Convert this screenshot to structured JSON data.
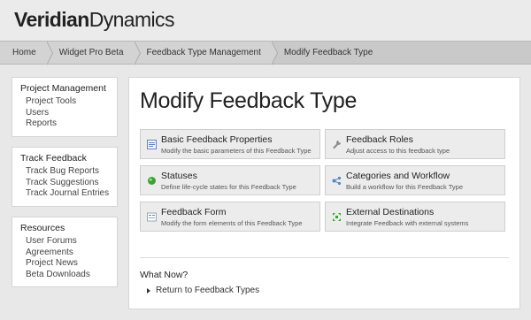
{
  "header": {
    "logo_bold": "Veridian",
    "logo_light": "Dynamics"
  },
  "breadcrumb": [
    "Home",
    "Widget Pro Beta",
    "Feedback Type Management",
    "Modify Feedback Type"
  ],
  "sidebar": [
    {
      "title": "Project Management",
      "links": [
        "Project Tools",
        "Users",
        "Reports"
      ]
    },
    {
      "title": "Track Feedback",
      "links": [
        "Track Bug Reports",
        "Track Suggestions",
        "Track Journal Entries"
      ]
    },
    {
      "title": "Resources",
      "links": [
        "User Forums",
        "Agreements",
        "Project News",
        "Beta Downloads"
      ]
    }
  ],
  "main": {
    "title": "Modify Feedback Type",
    "tiles": [
      {
        "title": "Basic Feedback Properties",
        "desc": "Modify the basic parameters of this Feedback Type",
        "icon": "properties-icon"
      },
      {
        "title": "Feedback Roles",
        "desc": "Adjust access to this feedback type",
        "icon": "wrench-icon"
      },
      {
        "title": "Statuses",
        "desc": "Define life-cycle states for this Feedback Type",
        "icon": "status-dot-icon"
      },
      {
        "title": "Categories and Workflow",
        "desc": "Build a workflow for this Feedback Type",
        "icon": "workflow-icon"
      },
      {
        "title": "Feedback Form",
        "desc": "Modify the form elements of this Feedback Type",
        "icon": "form-icon"
      },
      {
        "title": "External Destinations",
        "desc": "Integrate Feedback with external systems",
        "icon": "external-icon"
      }
    ],
    "what_now": "What Now?",
    "return_link": "Return to Feedback Types"
  },
  "colors": {
    "status_green": "#3aa335",
    "icon_blue": "#5b86c4",
    "breadcrumb_bg": "#c9c9c9"
  }
}
